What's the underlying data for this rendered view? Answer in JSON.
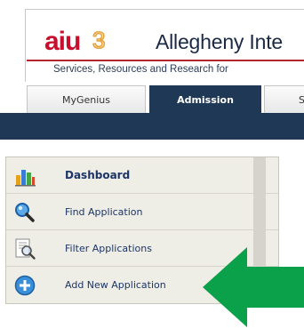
{
  "header": {
    "logo_text": "aiu3",
    "org_name": "Allegheny Inte",
    "tagline": "Services, Resources and Research for"
  },
  "tabs": [
    {
      "label": "MyGenius",
      "active": false
    },
    {
      "label": "Admission",
      "active": true
    },
    {
      "label": "S",
      "active": false
    }
  ],
  "menu": {
    "items": [
      {
        "label": "Dashboard",
        "icon": "dashboard-chart-icon",
        "active": true
      },
      {
        "label": "Find Application",
        "icon": "magnifier-icon",
        "active": false
      },
      {
        "label": "Filter Applications",
        "icon": "document-search-icon",
        "active": false
      },
      {
        "label": "Add New Application",
        "icon": "add-circle-icon",
        "active": false
      }
    ]
  },
  "colors": {
    "nav_bar": "#1f3855",
    "logo_red": "#c8102e",
    "accent_gold": "#e8a33a",
    "menu_bg": "#eeede6",
    "menu_text": "#1d3566",
    "arrow_green": "#0aa14a"
  }
}
